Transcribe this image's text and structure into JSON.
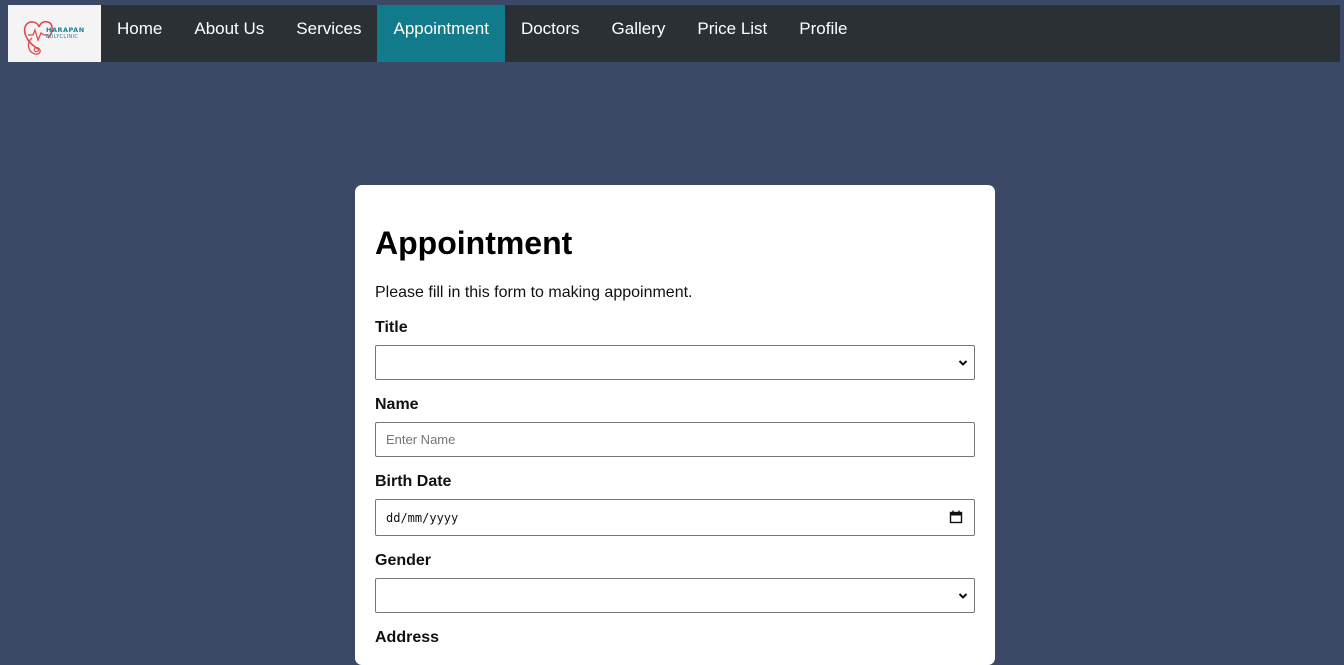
{
  "brand": {
    "line1": "HARAPAN",
    "line2": "POLYCLINIC",
    "icon": "heart-stethoscope-logo",
    "color": "#e04a4a"
  },
  "nav": {
    "items": [
      {
        "label": "Home",
        "active": false
      },
      {
        "label": "About Us",
        "active": false
      },
      {
        "label": "Services",
        "active": false
      },
      {
        "label": "Appointment",
        "active": true
      },
      {
        "label": "Doctors",
        "active": false
      },
      {
        "label": "Gallery",
        "active": false
      },
      {
        "label": "Price List",
        "active": false
      },
      {
        "label": "Profile",
        "active": false
      }
    ],
    "active_color": "#117a8b"
  },
  "form": {
    "heading": "Appointment",
    "intro": "Please fill in this form to making appoinment.",
    "title_label": "Title",
    "title_value": "",
    "name_label": "Name",
    "name_placeholder": "Enter Name",
    "birth_label": "Birth Date",
    "birth_placeholder": "dd/mm/yyyy",
    "gender_label": "Gender",
    "gender_value": "",
    "address_label": "Address"
  },
  "colors": {
    "page_bg": "#3b4966",
    "navbar_bg": "#2b3035"
  }
}
